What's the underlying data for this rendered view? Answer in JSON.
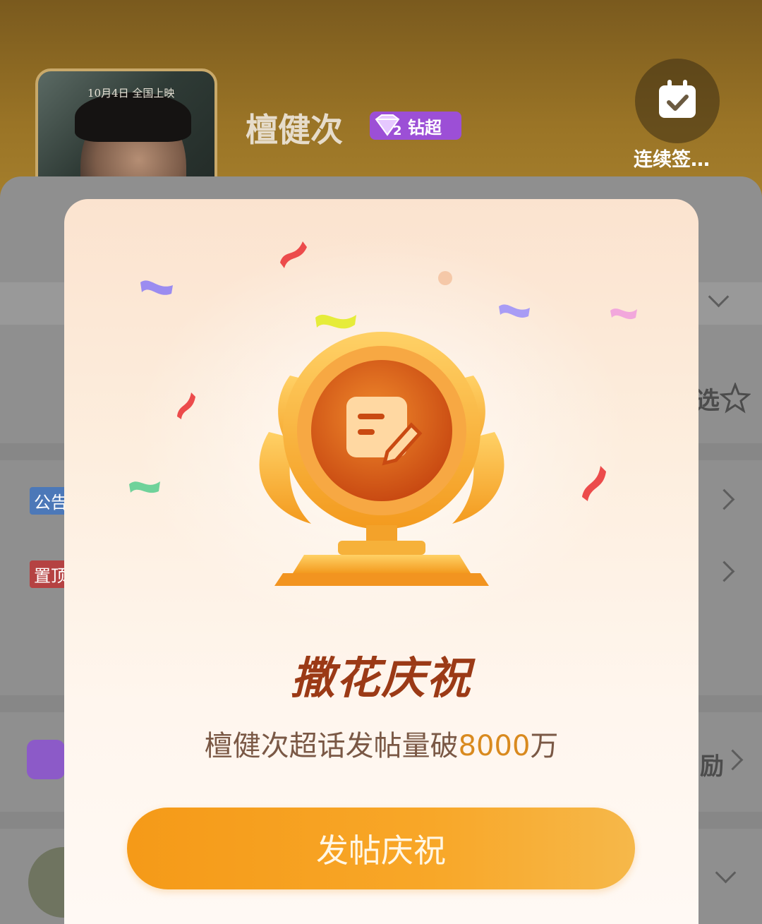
{
  "header": {
    "poster_text": "10月4日 全国上映",
    "title": "檀健次",
    "badge": {
      "level": "2",
      "label": "钻超",
      "icon": "diamond-icon",
      "color": "#9c4fd6"
    },
    "checkin": {
      "label": "连续签…",
      "icon": "calendar-check-icon"
    }
  },
  "background_rows": {
    "notice_tag": "公告",
    "pinned_tag": "置顶",
    "right_fragment_1": "选",
    "right_fragment_2": "励"
  },
  "modal": {
    "title": "撒花庆祝",
    "message_prefix": "檀健次超话发帖量破",
    "message_number": "8000",
    "message_suffix": "万",
    "button_label": "发帖庆祝",
    "icon": "post-edit-trophy-icon",
    "colors": {
      "accent": "#f59a18",
      "title": "#9b3a16",
      "number": "#d98a1f"
    }
  }
}
